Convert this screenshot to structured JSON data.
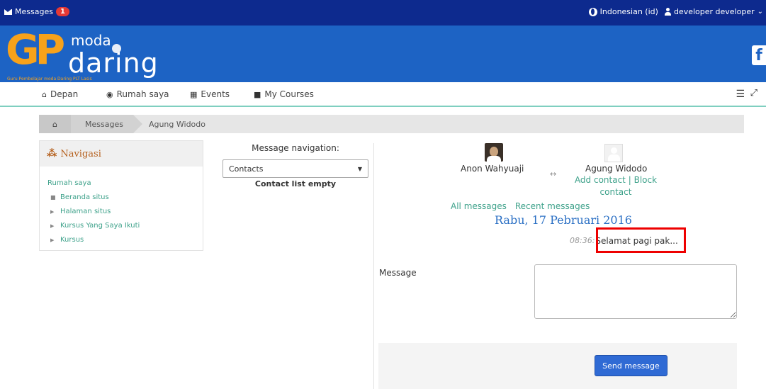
{
  "topbar": {
    "messages_label": "Messages",
    "messages_count": "1",
    "language": "Indonesian (id)",
    "user": "developer developer"
  },
  "brand": {
    "logo_g": "GP",
    "logo_moda": "moda",
    "logo_daring": "daring",
    "logo_sub": "Guru Pembelajar moda Daring PLT Lasis",
    "fb": "f"
  },
  "nav": {
    "items": [
      "Depan",
      "Rumah saya",
      "Events",
      "My Courses"
    ]
  },
  "breadcrumb": {
    "home_icon": "home-icon",
    "items": [
      "Messages",
      "Agung Widodo"
    ]
  },
  "navigasi": {
    "title": "Navigasi",
    "root": "Rumah saya",
    "children": [
      "Beranda situs",
      "Halaman situs",
      "Kursus Yang Saya Ikuti",
      "Kursus"
    ]
  },
  "message_nav": {
    "label": "Message navigation:",
    "selected": "Contacts",
    "empty": "Contact list empty"
  },
  "conversation": {
    "user1": "Anon Wahyuaji",
    "user2": "Agung Widodo",
    "arrows": "↔",
    "add_contact": "Add contact",
    "sep": "|",
    "block_contact_1": "Block",
    "block_contact_2": "contact",
    "all_messages": "All messages",
    "recent_messages": "Recent messages",
    "date": "Rabu, 17 Pebruari 2016",
    "time": "08:36:",
    "text": "Selamat pagi pak..."
  },
  "compose": {
    "label": "Message",
    "send": "Send message"
  },
  "colors": {
    "topbar": "#0d2a8e",
    "banner": "#1d63c4",
    "accent_green": "#3fa28b",
    "send_button": "#2f6ad4",
    "highlight": "#e00000"
  }
}
